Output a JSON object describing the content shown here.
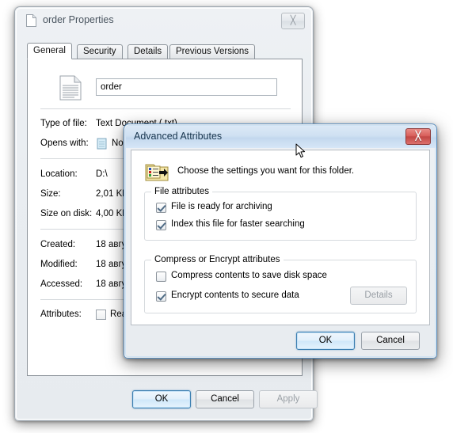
{
  "properties_window": {
    "title": "order Properties",
    "title_icon": "text-file-icon",
    "close_label": "╳",
    "tabs": [
      {
        "label": "General",
        "active": true
      },
      {
        "label": "Security",
        "active": false
      },
      {
        "label": "Details",
        "active": false
      },
      {
        "label": "Previous Versions",
        "active": false
      }
    ],
    "general": {
      "file_icon": "text-document-icon",
      "filename_value": "order",
      "rows": [
        {
          "label": "Type of file:",
          "value": "Text Document (.txt)"
        },
        {
          "label": "Opens with:",
          "value": "No"
        },
        {
          "label": "Location:",
          "value": "D:\\"
        },
        {
          "label": "Size:",
          "value": "2,01 KB"
        },
        {
          "label": "Size on disk:",
          "value": "4,00 KB"
        },
        {
          "label": "Created:",
          "value": "18 авгу"
        },
        {
          "label": "Modified:",
          "value": "18 авгу"
        },
        {
          "label": "Accessed:",
          "value": "18 авгу"
        },
        {
          "label": "Attributes:",
          "value": "Rea"
        }
      ],
      "opens_with_icon": "notepad-icon",
      "attributes_readonly_label": "Rea"
    },
    "buttons": {
      "ok": "OK",
      "cancel": "Cancel",
      "apply": "Apply"
    }
  },
  "advanced_dialog": {
    "title": "Advanced Attributes",
    "close_label": "╳",
    "header_icon": "folder-settings-icon",
    "prompt": "Choose the settings you want for this folder.",
    "file_attributes": {
      "group_title": "File attributes",
      "items": [
        {
          "label": "File is ready for archiving",
          "checked": true
        },
        {
          "label": "Index this file for faster searching",
          "checked": true
        }
      ]
    },
    "compress_encrypt": {
      "group_title": "Compress or Encrypt attributes",
      "items": [
        {
          "label": "Compress contents to save disk space",
          "checked": false
        },
        {
          "label": "Encrypt contents to secure data",
          "checked": true
        }
      ],
      "details_button": "Details"
    },
    "buttons": {
      "ok": "OK",
      "cancel": "Cancel"
    }
  },
  "colors": {
    "active_title": "#c3d8ee",
    "close_red": "#c24744",
    "default_button_border": "#3c7fb1"
  }
}
